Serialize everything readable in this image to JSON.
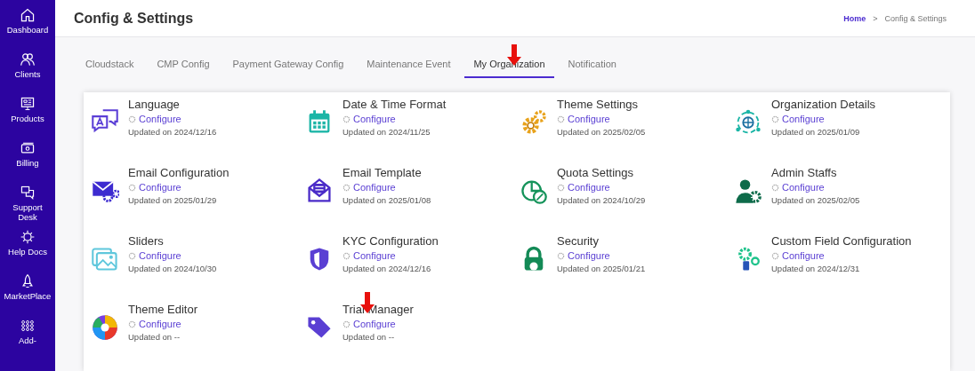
{
  "sidebar": {
    "items": [
      {
        "label": "Dashboard"
      },
      {
        "label": "Clients"
      },
      {
        "label": "Products"
      },
      {
        "label": "Billing"
      },
      {
        "label": "Support Desk"
      },
      {
        "label": "Help Docs"
      },
      {
        "label": "MarketPlace"
      },
      {
        "label": "Add-"
      }
    ]
  },
  "header": {
    "title": "Config & Settings",
    "breadcrumb": [
      {
        "label": "Home",
        "link": true
      },
      {
        "label": "Config & Settings",
        "link": false
      }
    ],
    "separator": ">"
  },
  "tabs": [
    {
      "label": "Cloudstack",
      "selected": false
    },
    {
      "label": "CMP Config",
      "selected": false
    },
    {
      "label": "Payment Gateway Config",
      "selected": false
    },
    {
      "label": "Maintenance Event",
      "selected": false
    },
    {
      "label": "My Organization",
      "selected": true
    },
    {
      "label": "Notification",
      "selected": false
    }
  ],
  "settings": [
    {
      "title": "Language",
      "action": "Configure",
      "updated": "Updated on 2024/12/16"
    },
    {
      "title": "Date & Time Format",
      "action": "Configure",
      "updated": "Updated on 2024/11/25"
    },
    {
      "title": "Theme Settings",
      "action": "Configure",
      "updated": "Updated on 2025/02/05"
    },
    {
      "title": "Organization Details",
      "action": "Configure",
      "updated": "Updated on 2025/01/09"
    },
    {
      "title": "Email Configuration",
      "action": "Configure",
      "updated": "Updated on 2025/01/29"
    },
    {
      "title": "Email Template",
      "action": "Configure",
      "updated": "Updated on 2025/01/08"
    },
    {
      "title": "Quota Settings",
      "action": "Configure",
      "updated": "Updated on 2024/10/29"
    },
    {
      "title": "Admin Staffs",
      "action": "Configure",
      "updated": "Updated on 2025/02/05"
    },
    {
      "title": "Sliders",
      "action": "Configure",
      "updated": "Updated on 2024/10/30"
    },
    {
      "title": "KYC Configuration",
      "action": "Configure",
      "updated": "Updated on 2024/12/16"
    },
    {
      "title": "Security",
      "action": "Configure",
      "updated": "Updated on 2025/01/21"
    },
    {
      "title": "Custom Field Configuration",
      "action": "Configure",
      "updated": "Updated on 2024/12/31"
    },
    {
      "title": "Theme Editor",
      "action": "Configure",
      "updated": "Updated on --"
    },
    {
      "title": "Trial Manager",
      "action": "Configure",
      "updated": "Updated on --"
    }
  ]
}
